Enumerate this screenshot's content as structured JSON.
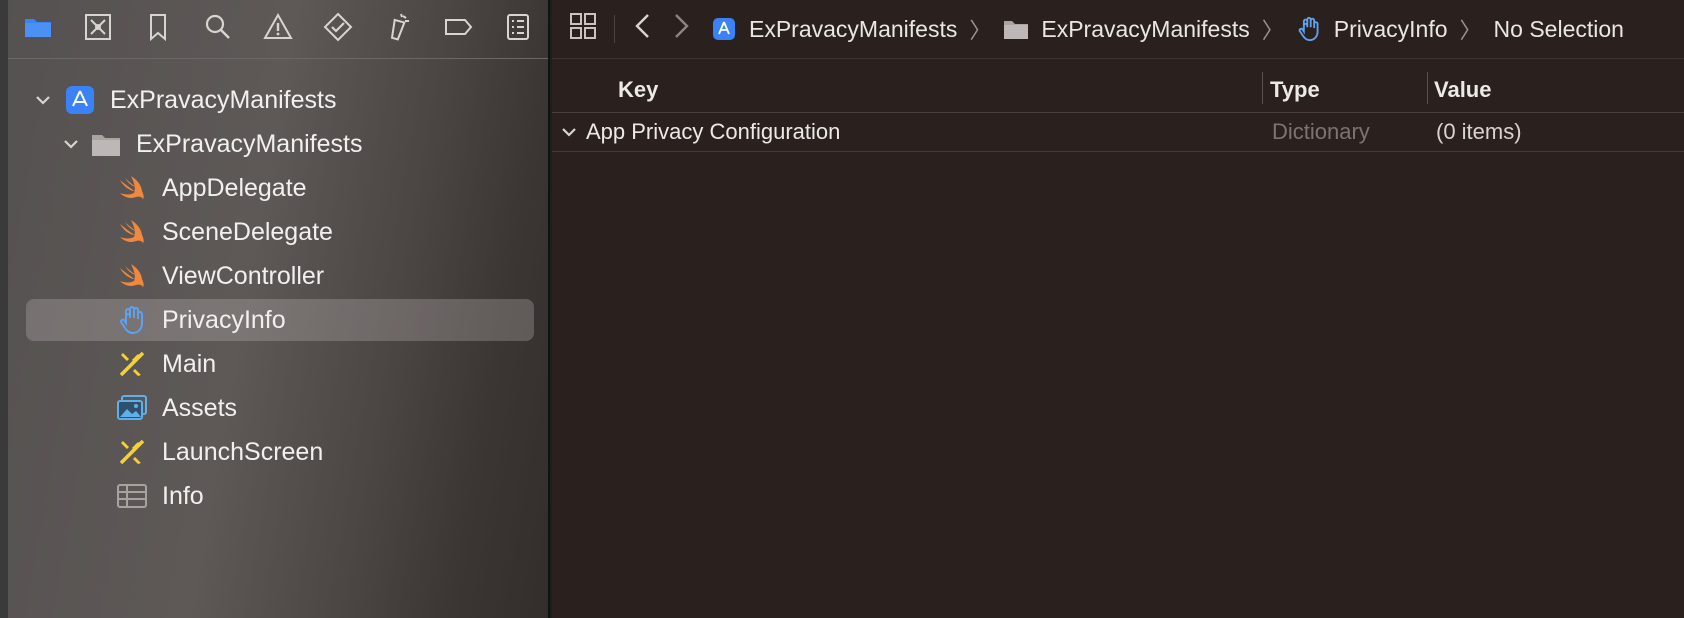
{
  "navigator": {
    "toolbar_icons": [
      "folder-icon",
      "source-control-icon",
      "bookmark-icon",
      "search-icon",
      "warning-icon",
      "test-icon",
      "debug-icon",
      "breakpoint-icon",
      "report-icon"
    ],
    "project": {
      "label": "ExPravacyManifests",
      "group": {
        "label": "ExPravacyManifests",
        "files": [
          {
            "label": "AppDelegate",
            "icon": "swift-icon"
          },
          {
            "label": "SceneDelegate",
            "icon": "swift-icon"
          },
          {
            "label": "ViewController",
            "icon": "swift-icon"
          },
          {
            "label": "PrivacyInfo",
            "icon": "privacy-hand-icon",
            "selected": true
          },
          {
            "label": "Main",
            "icon": "storyboard-icon"
          },
          {
            "label": "Assets",
            "icon": "assets-icon"
          },
          {
            "label": "LaunchScreen",
            "icon": "storyboard-icon"
          },
          {
            "label": "Info",
            "icon": "plist-icon"
          }
        ]
      }
    }
  },
  "jumpbar": {
    "crumbs": [
      {
        "label": "ExPravacyManifests",
        "icon": "project-icon"
      },
      {
        "label": "ExPravacyManifests",
        "icon": "folder-icon"
      },
      {
        "label": "PrivacyInfo",
        "icon": "privacy-hand-icon"
      },
      {
        "label": "No Selection"
      }
    ],
    "separator": "〉"
  },
  "plist": {
    "columns": {
      "key": "Key",
      "type": "Type",
      "value": "Value"
    },
    "rows": [
      {
        "key": "App Privacy Configuration",
        "type": "Dictionary",
        "value": "(0 items)"
      }
    ]
  },
  "colors": {
    "swift": "#f0883e",
    "accent_blue": "#3b82f6",
    "storyboard_yellow": "#f5d132",
    "assets_blue": "#5fb0e8",
    "type_gray": "#7d7370"
  }
}
